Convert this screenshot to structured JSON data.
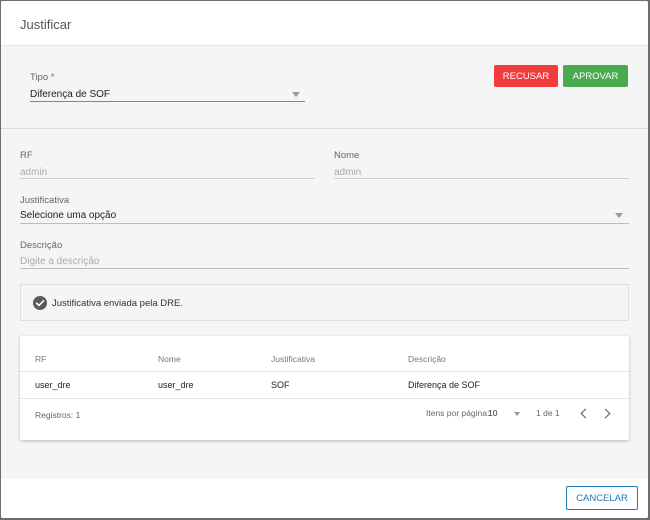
{
  "dialog": {
    "title": "Justificar"
  },
  "form": {
    "tipo": {
      "label": "Tipo",
      "required_mark": "*",
      "value": "Diferença de SOF"
    },
    "actions": {
      "recusar": "RECUSAR",
      "aprovar": "APROVAR"
    },
    "rf": {
      "label": "RF",
      "value": "admin"
    },
    "nome": {
      "label": "Nome",
      "value": "admin"
    },
    "justificativa": {
      "label": "Justificativa",
      "value": "Selecione uma opção"
    },
    "descricao": {
      "label": "Descrição",
      "placeholder": "Digite a descrição"
    }
  },
  "notice": {
    "text": "Justificativa enviada pela DRE.",
    "icon": "check-circle-icon"
  },
  "table": {
    "columns": [
      "RF",
      "Nome",
      "Justificativa",
      "Descrição"
    ],
    "rows": [
      [
        "user_dre",
        "user_dre",
        "SOF",
        "Diferença de SOF"
      ]
    ],
    "footer": {
      "records": "Registros: 1",
      "per_page_label": "Itens por página:",
      "per_page_value": "10",
      "range": "1 de 1"
    }
  },
  "footer": {
    "cancel": "CANCELAR"
  },
  "colors": {
    "recusar": "#f03c3c",
    "aprovar": "#4aaa4f",
    "cancel": "#1f78b4"
  }
}
